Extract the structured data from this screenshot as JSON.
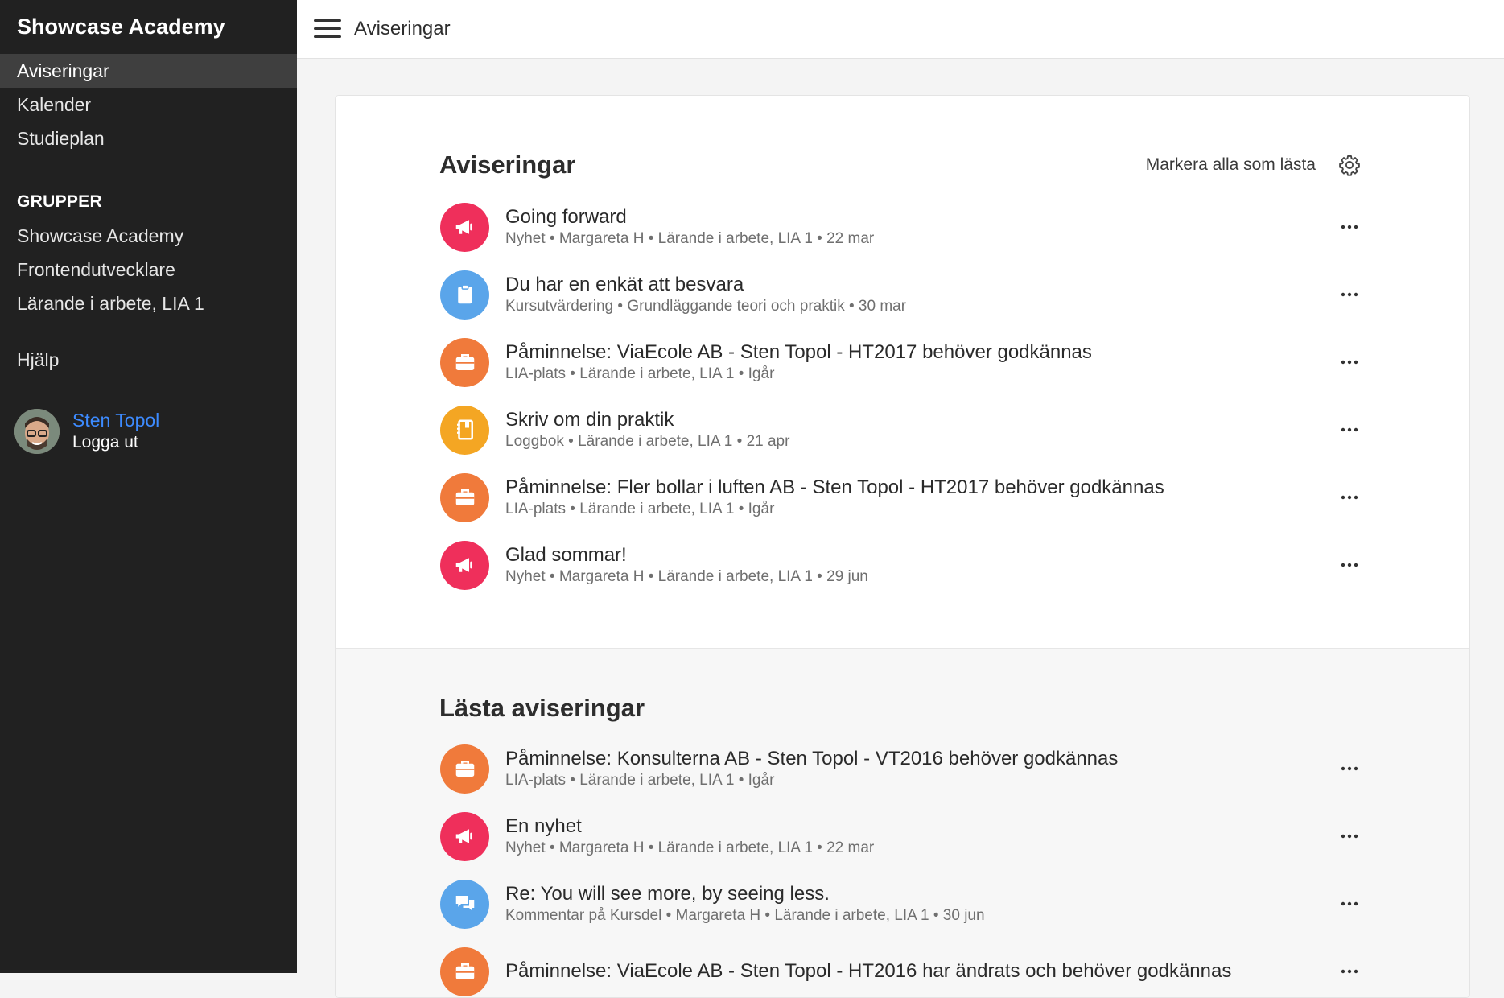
{
  "app": {
    "brand": "Showcase Academy"
  },
  "sidebar": {
    "nav": [
      {
        "label": "Aviseringar",
        "active": true
      },
      {
        "label": "Kalender",
        "active": false
      },
      {
        "label": "Studieplan",
        "active": false
      }
    ],
    "groups_heading": "GRUPPER",
    "groups": [
      "Showcase Academy",
      "Frontendutvecklare",
      "Lärande i arbete, LIA 1"
    ],
    "help": "Hjälp",
    "user": {
      "name": "Sten Topol",
      "logout": "Logga ut"
    }
  },
  "topbar": {
    "title": "Aviseringar"
  },
  "unread": {
    "title": "Aviseringar",
    "mark_all": "Markera alla som lästa",
    "items": [
      {
        "icon": "megaphone-icon",
        "color": "#ef2f5b",
        "title": "Going forward",
        "meta": "Nyhet • Margareta H • Lärande i arbete, LIA 1 • 22 mar"
      },
      {
        "icon": "clipboard-icon",
        "color": "#5aa5ea",
        "title": "Du har en enkät att besvara",
        "meta": "Kursutvärdering • Grundläggande teori och praktik • 30 mar"
      },
      {
        "icon": "briefcase-icon",
        "color": "#f07a3b",
        "title": "Påminnelse: ViaEcole AB - Sten Topol - HT2017 behöver godkännas",
        "meta": "LIA-plats • Lärande i arbete, LIA 1 • Igår"
      },
      {
        "icon": "notebook-icon",
        "color": "#f4a623",
        "title": "Skriv om din praktik",
        "meta": "Loggbok • Lärande i arbete, LIA 1 • 21 apr"
      },
      {
        "icon": "briefcase-icon",
        "color": "#f07a3b",
        "title": "Påminnelse: Fler bollar i luften AB - Sten Topol - HT2017 behöver godkännas",
        "meta": "LIA-plats • Lärande i arbete, LIA 1 • Igår"
      },
      {
        "icon": "megaphone-icon",
        "color": "#ef2f5b",
        "title": "Glad sommar!",
        "meta": "Nyhet • Margareta H • Lärande i arbete, LIA 1 • 29 jun"
      }
    ]
  },
  "read": {
    "title": "Lästa aviseringar",
    "items": [
      {
        "icon": "briefcase-icon",
        "color": "#f07a3b",
        "title": "Påminnelse: Konsulterna AB - Sten Topol - VT2016 behöver godkännas",
        "meta": "LIA-plats • Lärande i arbete, LIA 1 • Igår"
      },
      {
        "icon": "megaphone-icon",
        "color": "#ef2f5b",
        "title": "En nyhet",
        "meta": "Nyhet • Margareta H • Lärande i arbete, LIA 1 • 22 mar"
      },
      {
        "icon": "chat-bubbles-icon",
        "color": "#5aa5ea",
        "title": "Re: You will see more, by seeing less.",
        "meta": "Kommentar på Kursdel • Margareta H • Lärande i arbete, LIA 1 • 30 jun"
      },
      {
        "icon": "briefcase-icon",
        "color": "#f07a3b",
        "title": "Påminnelse: ViaEcole AB - Sten Topol - HT2016 har ändrats och behöver godkännas",
        "meta": ""
      }
    ]
  }
}
